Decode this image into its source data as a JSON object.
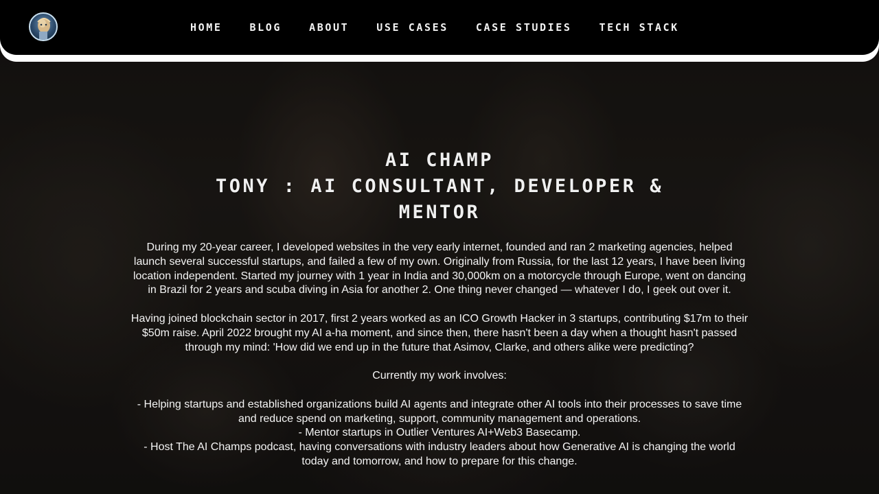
{
  "nav": {
    "logo_alt": "AI Champ logo",
    "items": [
      {
        "label": "HOME"
      },
      {
        "label": "BLOG"
      },
      {
        "label": "ABOUT"
      },
      {
        "label": "USE CASES"
      },
      {
        "label": "CASE STUDIES"
      },
      {
        "label": "TECH STACK"
      }
    ]
  },
  "hero": {
    "title": "AI CHAMP",
    "subtitle": "TONY : AI CONSULTANT, DEVELOPER & MENTOR"
  },
  "bio": {
    "paragraph_1": "During my 20-year career, I developed websites in the very early internet, founded and ran 2 marketing agencies, helped launch several successful startups, and failed a few of my own. Originally from Russia, for the last 12 years, I have been living location independent. Started my journey with 1 year in India and 30,000km on a motorcycle through Europe, went on dancing in Brazil for 2 years and scuba diving in Asia for another 2. One thing never changed — whatever I do, I geek out over it.",
    "paragraph_2": "Having joined blockchain sector in 2017, first 2 years worked as an ICO Growth Hacker in 3 startups, contributing $17m to their $50m raise. April 2022 brought my AI a-ha moment, and since then, there hasn't been a day when a thought hasn't passed through my mind: 'How did we end up in the future that Asimov, Clarke, and others alike were predicting?",
    "work_intro": "Currently my work involves:",
    "work_items": [
      "- Helping startups and established organizations build AI agents and integrate other AI tools into their processes to save time and reduce spend on marketing, support, community management and operations.",
      "- Mentor startups in Outlier Ventures AI+Web3 Basecamp.",
      "- Host The AI Champs podcast, having conversations with industry leaders about how Generative AI is changing the world today and tomorrow, and how to prepare for this change."
    ]
  }
}
